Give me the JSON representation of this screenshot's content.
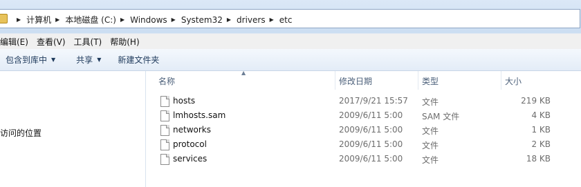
{
  "breadcrumb": [
    "计算机",
    "本地磁盘 (C:)",
    "Windows",
    "System32",
    "drivers",
    "etc"
  ],
  "menu": [
    "编辑(E)",
    "查看(V)",
    "工具(T)",
    "帮助(H)"
  ],
  "toolbar": {
    "include_label": "包含到库中",
    "share_label": "共享",
    "new_folder_label": "新建文件夹"
  },
  "nav": {
    "recent_label": "访问的位置"
  },
  "columns": {
    "name": "名称",
    "date": "修改日期",
    "type": "类型",
    "size": "大小"
  },
  "files": [
    {
      "name": "hosts",
      "date": "2017/9/21 15:57",
      "type": "文件",
      "size": "219 KB"
    },
    {
      "name": "lmhosts.sam",
      "date": "2009/6/11 5:00",
      "type": "SAM 文件",
      "size": "4 KB"
    },
    {
      "name": "networks",
      "date": "2009/6/11 5:00",
      "type": "文件",
      "size": "1 KB"
    },
    {
      "name": "protocol",
      "date": "2009/6/11 5:00",
      "type": "文件",
      "size": "2 KB"
    },
    {
      "name": "services",
      "date": "2009/6/11 5:00",
      "type": "文件",
      "size": "18 KB"
    }
  ]
}
